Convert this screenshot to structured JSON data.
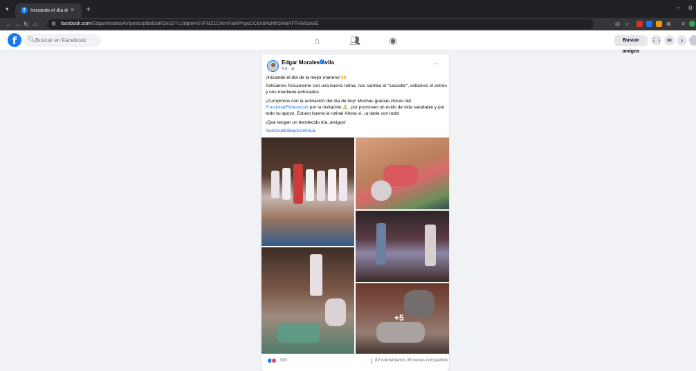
{
  "browser": {
    "tab_title": "Iniciando el día de la mejor ma",
    "tab_close": "×",
    "new_tab": "+",
    "minimize": "–",
    "close": "o",
    "url_host": "facebook.com",
    "url_path": "/EdgarMoralesAV/posts/pfbid0aRGe1BYUJdqnk4XVFMZ1DAhnFaMPKpoDCaX8AzMhSWaRFTHMSaWE"
  },
  "facebook": {
    "logo": "f",
    "search_placeholder": "Buscar en Facebook",
    "find_friends": "Buscar amigos"
  },
  "post": {
    "author": "Edgar Morales Avila",
    "timestamp": "4 d · ",
    "more": "···",
    "paragraphs": [
      "¡Iniciando el día de la mejor manera! 🙌",
      "Activamos físicamente con una buena rutina, nos cambia el \"cassette\", soltamos el estrés y nos mantiene enfocados.",
      "¡Cumplimos con la activación del día de hoy! Muchas gracias chicas del ",
      " por la invitación 🙏, por promover un estilo de vida saludable y por todo su apoyo. Estuvo buena la rutina! Ahora sí, ¡a darle con todo!",
      "¡Que tengan un bendecido día, amigos!"
    ],
    "mention": "FuncionalFitnessclub",
    "hashtag": "#juntosaltrabajocontinua",
    "extra_photos": "+5",
    "reaction_count": "330",
    "comments": "82 comentarios",
    "shares": "35 veces compartido"
  }
}
